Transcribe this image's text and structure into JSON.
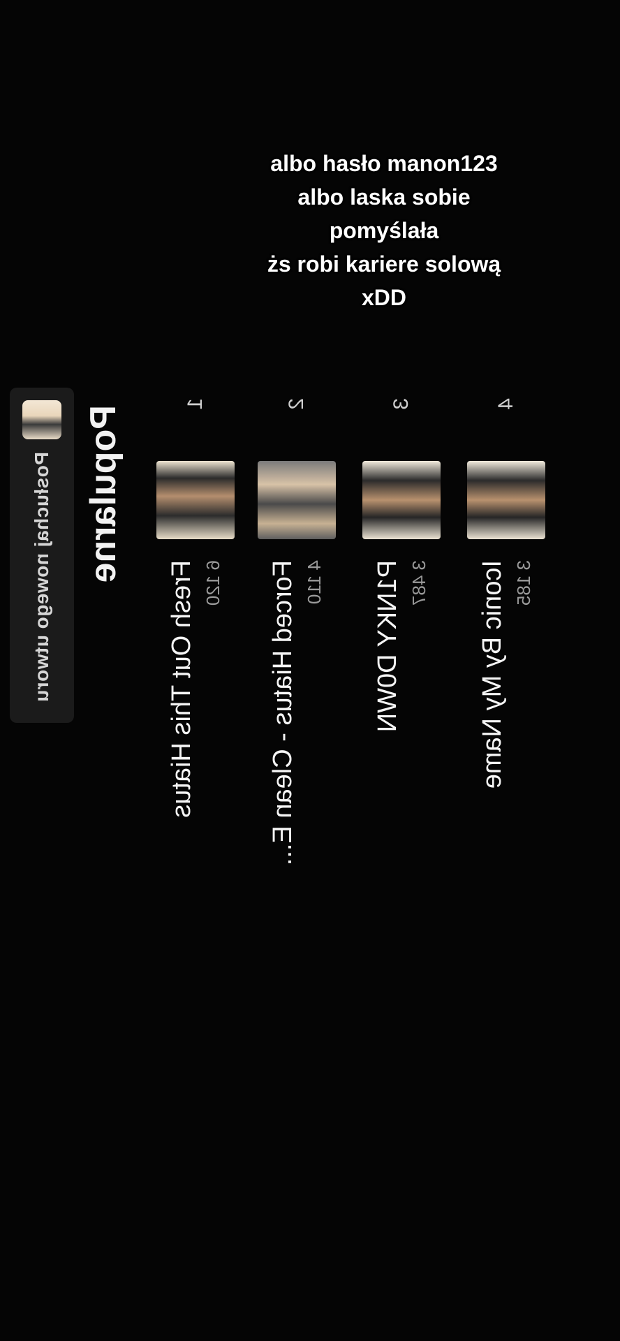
{
  "header": {
    "listen_label": "Posłuchaj nowego utworu"
  },
  "section": {
    "title": "Popularne"
  },
  "tracks": [
    {
      "rank": "1",
      "title": "Fresh Out This Hiatus",
      "plays": "6 120",
      "more": "⋮"
    },
    {
      "rank": "2",
      "title": "Forced Hiatus - Clean E...",
      "plays": "4 110",
      "more": "⋮"
    },
    {
      "rank": "3",
      "title": "P1NKY D0WN",
      "plays": "3 487",
      "more": "⋮"
    },
    {
      "rank": "4",
      "title": "Iconic By My Name",
      "plays": "3 185",
      "more": "⋮"
    }
  ],
  "overlay_caption": [
    "albo hasło manon123",
    "albo laska sobie pomyślała",
    "żs robi kariere solową xDD"
  ],
  "icons": {
    "chevron_up": "chevron-up-icon",
    "chevron_down": "chevron-down-icon",
    "more": "more-vertical-icon"
  },
  "colors": {
    "background": "#050505",
    "pill": "#1b1b1b",
    "text_primary": "#f5f5f5",
    "text_secondary": "#9a9a9a"
  }
}
